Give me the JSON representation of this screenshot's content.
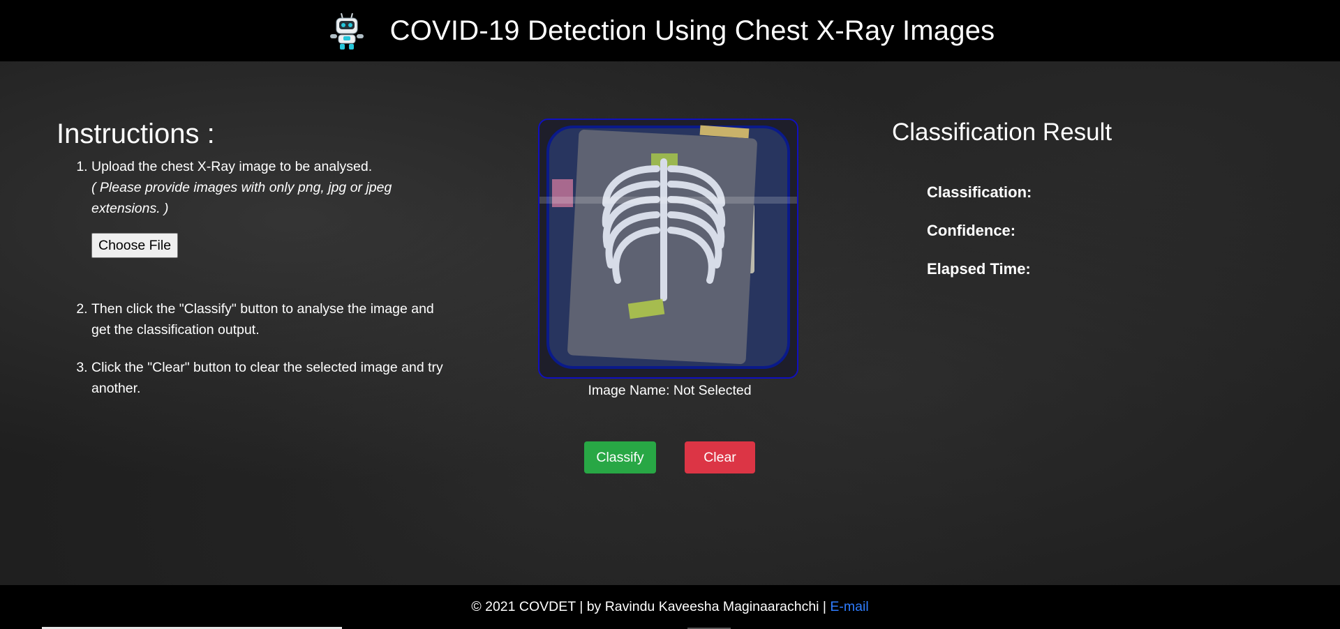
{
  "header": {
    "title": "COVID-19 Detection Using Chest X-Ray Images",
    "logo_icon": "robot-icon"
  },
  "instructions": {
    "heading": "Instructions :",
    "step1_text": "Upload the chest X-Ray image to be analysed.",
    "step1_note": "( Please provide images with only png, jpg or jpeg extensions. )",
    "file_button_label": "Choose File",
    "step2_text": "Then click the \"Classify\" button to analyse the image and get the classification output.",
    "step3_text": "Click the \"Clear\" button to clear the selected image and try another."
  },
  "preview": {
    "image_icon": "chest-xray-placeholder-icon",
    "image_name_label": "Image Name: Not Selected"
  },
  "actions": {
    "classify_label": "Classify",
    "clear_label": "Clear"
  },
  "results": {
    "heading": "Classification Result",
    "classification_label": "Classification:",
    "confidence_label": "Confidence:",
    "elapsed_label": "Elapsed Time:"
  },
  "footer": {
    "text": "© 2021 COVDET | by Ravindu Kaveesha Maginaarachchi | ",
    "email_label": "E-mail"
  },
  "colors": {
    "classify": "#28a745",
    "clear": "#dc3545",
    "link": "#2f7dff",
    "preview_border": "#1010c0"
  }
}
